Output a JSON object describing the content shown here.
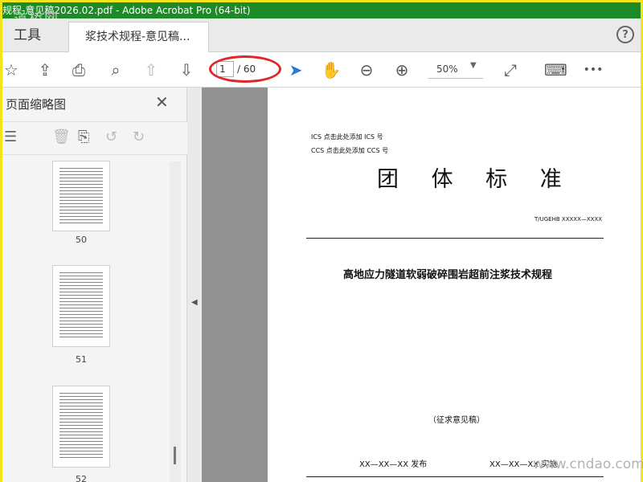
{
  "window": {
    "title": "规程-意见稿2026.02.pdf - Adobe Acrobat Pro (64-bit)"
  },
  "tabs": {
    "tools": "工具",
    "document": "浆技术规程-意见稿..."
  },
  "toolbar": {
    "page_current": "1",
    "page_total": "/ 60",
    "zoom": "50%"
  },
  "icons": {
    "star": "☆",
    "cloud_upload": "⇪",
    "print": "⎙",
    "zoom_search": "⌕",
    "prev_page": "⇧",
    "next_page": "⇩",
    "select": "➤",
    "hand": "✋",
    "zoom_out": "⊖",
    "zoom_in": "⊕",
    "fit_page": "⤢",
    "keyboard": "⌨",
    "more": "•••",
    "help": "?",
    "close": "✕",
    "thumbs_menu": "☰",
    "trash": "🗑",
    "insert": "⎘",
    "rotate_left": "↺",
    "rotate_right": "↻",
    "collapse": "◀"
  },
  "sidebar": {
    "title": "页面缩略图",
    "thumbnails": [
      {
        "label": "50"
      },
      {
        "label": "51"
      },
      {
        "label": "52"
      }
    ]
  },
  "document": {
    "ics": "ICS 点击此处添加 ICS 号",
    "ccs": "CCS 点击此处添加 CCS 号",
    "title": "团 体 标 准",
    "standard_no": "T/UGEHB XXXXX—XXXX",
    "name": "高地应力隧道软弱破碎围岩超前注浆技术规程",
    "draft": "（征求意见稿）",
    "issue_date": "XX—XX—XX 发布",
    "implement_date": "XX—XX—XX 实施"
  },
  "watermarks": {
    "site": "www.cndao.com",
    "logo": "道桥网"
  },
  "colors": {
    "titlebar": "#1b8a27",
    "highlight": "#e0262a",
    "select_tool": "#2a7bd4"
  }
}
